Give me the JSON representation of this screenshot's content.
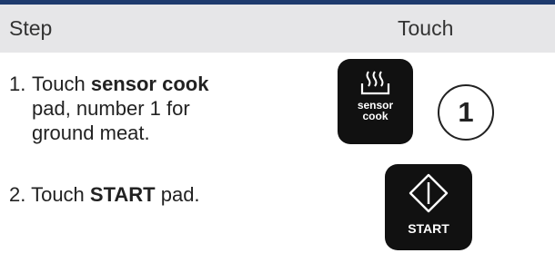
{
  "header": {
    "step": "Step",
    "touch": "Touch"
  },
  "steps": [
    {
      "number": "1.",
      "pre": "Touch ",
      "bold": "sensor cook",
      "rest_line1": "",
      "line2": "pad, number 1 for",
      "line3": "ground meat."
    },
    {
      "number": "2.",
      "pre": "Touch ",
      "bold": "START",
      "post": " pad."
    }
  ],
  "pads": {
    "sensor_label_1": "sensor",
    "sensor_label_2": "cook",
    "number_button": "1",
    "start_label": "START"
  },
  "colors": {
    "header_bg": "#e6e6e8",
    "rule": "#1e3a6d",
    "pad": "#111111"
  }
}
